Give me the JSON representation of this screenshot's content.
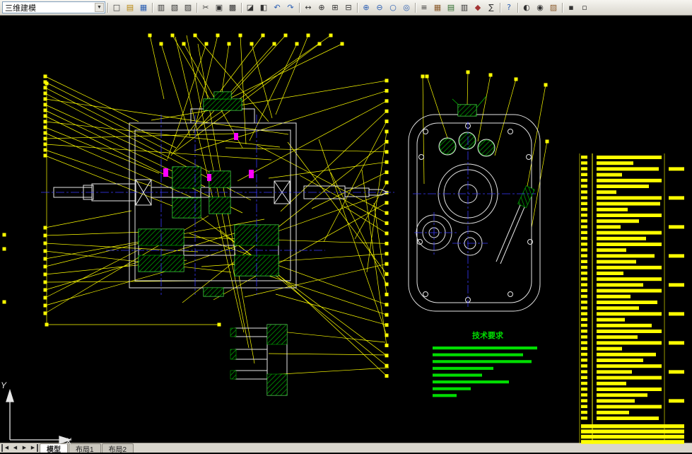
{
  "toolbar": {
    "workspace": "三维建模",
    "groups": [
      [
        {
          "name": "new-file",
          "glyph": "□",
          "color": "#333333"
        },
        {
          "name": "open-file",
          "glyph": "▤",
          "color": "#b8860b"
        },
        {
          "name": "save",
          "glyph": "▦",
          "color": "#2b5fb4"
        }
      ],
      [
        {
          "name": "plot",
          "glyph": "▥",
          "color": "#333333"
        },
        {
          "name": "plot-preview",
          "glyph": "▧",
          "color": "#333333"
        },
        {
          "name": "publish",
          "glyph": "▨",
          "color": "#333333"
        }
      ],
      [
        {
          "name": "cut",
          "glyph": "✂",
          "color": "#444444"
        },
        {
          "name": "copy",
          "glyph": "▣",
          "color": "#333333"
        },
        {
          "name": "paste",
          "glyph": "▩",
          "color": "#333333"
        }
      ],
      [
        {
          "name": "match-properties",
          "glyph": "◪",
          "color": "#333333"
        },
        {
          "name": "block-editor",
          "glyph": "◧",
          "color": "#333333"
        },
        {
          "name": "undo",
          "glyph": "↶",
          "color": "#2b5fb4"
        },
        {
          "name": "redo",
          "glyph": "↷",
          "color": "#2b5fb4"
        }
      ],
      [
        {
          "name": "pan",
          "glyph": "↔",
          "color": "#333333"
        },
        {
          "name": "zoom-realtime",
          "glyph": "⊕",
          "color": "#333333"
        },
        {
          "name": "zoom-window",
          "glyph": "⊞",
          "color": "#333333"
        },
        {
          "name": "zoom-previous",
          "glyph": "⊟",
          "color": "#333333"
        }
      ],
      [
        {
          "name": "zoom-in",
          "glyph": "⊕",
          "color": "#2b5fb4"
        },
        {
          "name": "zoom-out",
          "glyph": "⊖",
          "color": "#2b5fb4"
        },
        {
          "name": "zoom-extents",
          "glyph": "○",
          "color": "#2b5fb4"
        },
        {
          "name": "zoom-all",
          "glyph": "◎",
          "color": "#2b5fb4"
        }
      ],
      [
        {
          "name": "properties",
          "glyph": "≡",
          "color": "#333333"
        },
        {
          "name": "designcenter",
          "glyph": "▦",
          "color": "#8a5a2b"
        },
        {
          "name": "tool-palettes",
          "glyph": "▤",
          "color": "#2b6b2b"
        },
        {
          "name": "sheet-set-manager",
          "glyph": "▥",
          "color": "#333333"
        },
        {
          "name": "markup",
          "glyph": "◆",
          "color": "#a33333"
        },
        {
          "name": "quickcalc",
          "glyph": "∑",
          "color": "#333333"
        }
      ],
      [
        {
          "name": "help",
          "glyph": "?",
          "color": "#2b5fb4"
        }
      ],
      [
        {
          "name": "render",
          "glyph": "◐",
          "color": "#333333"
        },
        {
          "name": "orbit",
          "glyph": "◉",
          "color": "#333333"
        },
        {
          "name": "materials",
          "glyph": "▨",
          "color": "#8a5a2b"
        }
      ],
      [
        {
          "name": "workspace-lock",
          "glyph": "▪",
          "color": "#333333"
        },
        {
          "name": "clean-screen",
          "glyph": "▫",
          "color": "#333333"
        }
      ]
    ]
  },
  "tabbar": {
    "nav": [
      {
        "name": "first-tab-button",
        "glyph": "◀",
        "end": "left"
      },
      {
        "name": "prev-tab-button",
        "glyph": "◀"
      },
      {
        "name": "next-tab-button",
        "glyph": "▶"
      },
      {
        "name": "last-tab-button",
        "glyph": "▶",
        "end": "right"
      }
    ],
    "tabs": [
      {
        "name": "tab-model",
        "label": "模型",
        "active": true
      },
      {
        "name": "tab-layout1",
        "label": "布局1",
        "active": false
      },
      {
        "name": "tab-layout2",
        "label": "布局2",
        "active": false
      }
    ]
  },
  "canvas": {
    "tech_requirements_title": "技术要求",
    "ucs": {
      "x_label": "X",
      "y_label": "Y"
    }
  },
  "colors": {
    "line_white": "#e6e6e6",
    "leader_yellow": "#ffff00",
    "hatch_green": "#00cc00",
    "center_blue": "#3a3aff",
    "seal_magenta": "#ff00ff",
    "text_green": "#00dd00"
  }
}
